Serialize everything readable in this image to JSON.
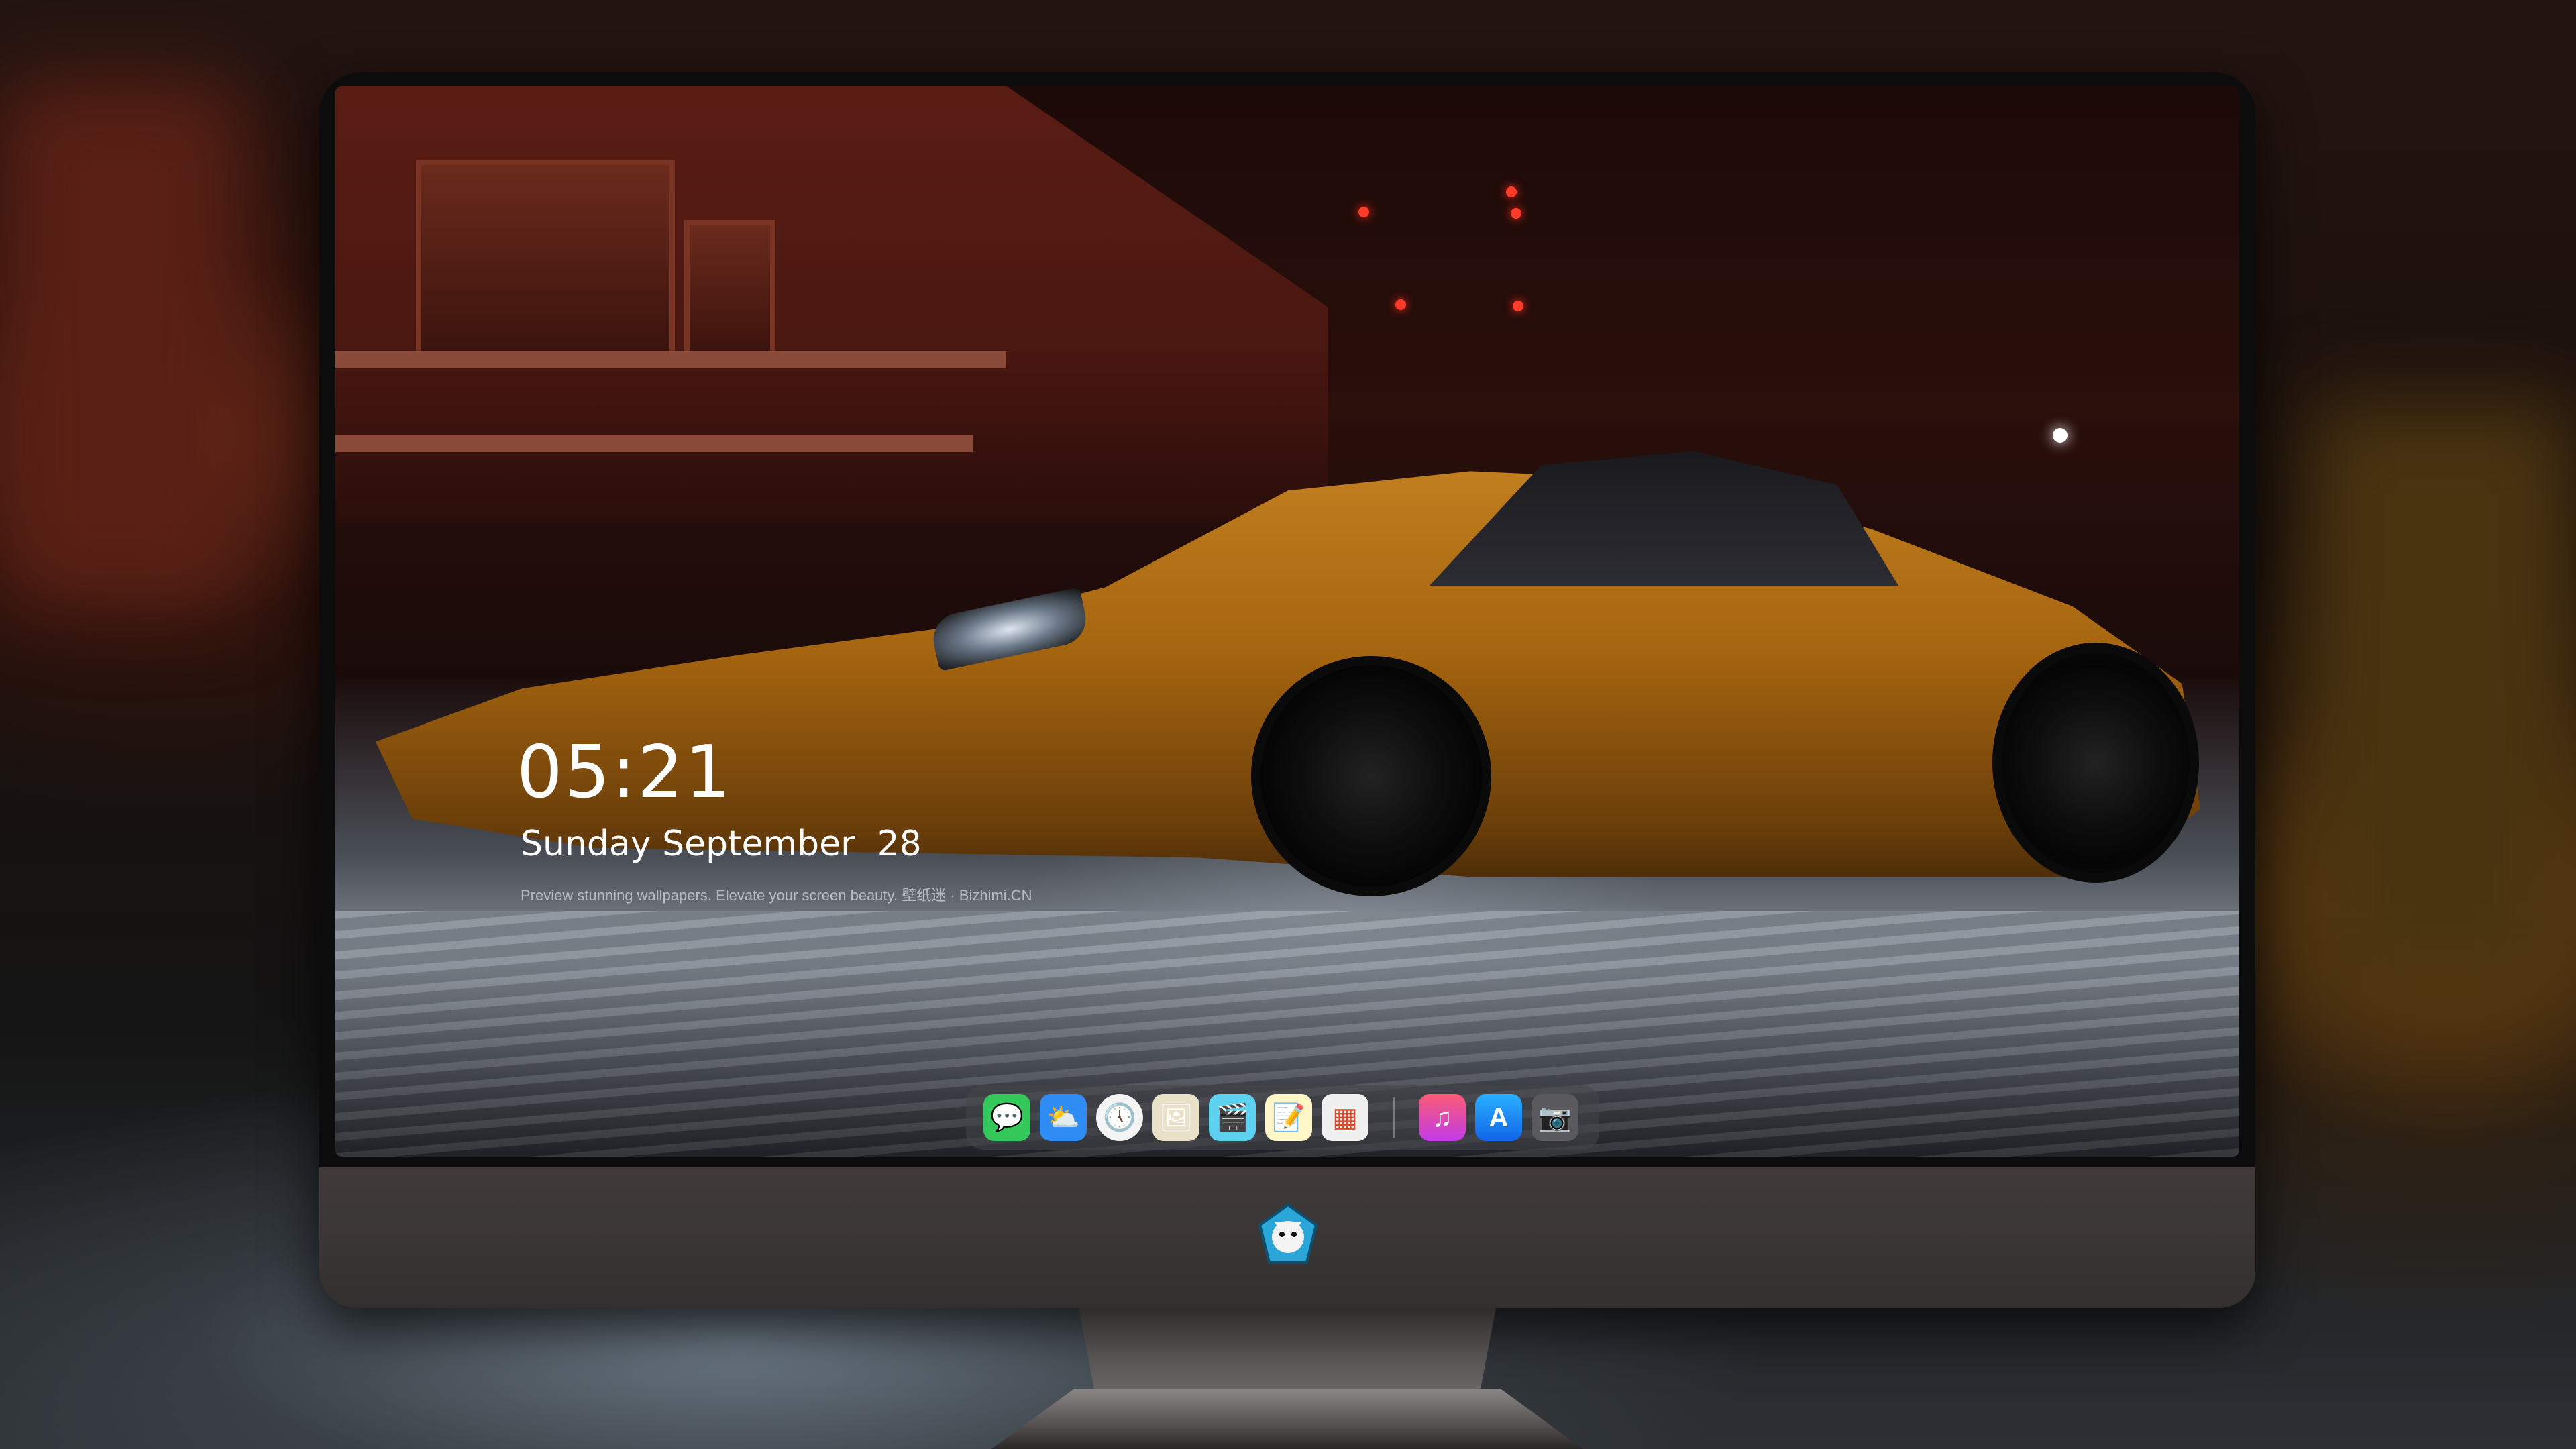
{
  "lockscreen": {
    "time": "05:21",
    "date": "Sunday September  28",
    "caption": "Preview stunning wallpapers. Elevate your screen beauty. 壁纸迷 · Bizhimi.CN"
  },
  "dock": {
    "apps": [
      {
        "name": "messages",
        "icon": "message-bubble-icon",
        "glyph": "💬",
        "color": "#34c759"
      },
      {
        "name": "weather",
        "icon": "weather-icon",
        "glyph": "⛅",
        "color": "#2f8cf5"
      },
      {
        "name": "clock",
        "icon": "clock-icon",
        "glyph": "🕔",
        "color": "#ffffff"
      },
      {
        "name": "preview",
        "icon": "preview-icon",
        "glyph": "🖼",
        "color": "#e9e2c8"
      },
      {
        "name": "clips",
        "icon": "clapperboard-icon",
        "glyph": "🎬",
        "color": "#5ed0f0"
      },
      {
        "name": "notes",
        "icon": "notes-icon",
        "glyph": "📝",
        "color": "#ffd84a"
      },
      {
        "name": "photo-booth",
        "icon": "photo-grid-icon",
        "glyph": "▦",
        "color": "#f0f0f0"
      },
      {
        "name": "music",
        "icon": "music-note-icon",
        "glyph": "♫",
        "color": "#f24cb8"
      },
      {
        "name": "app-store",
        "icon": "app-store-icon",
        "glyph": "A",
        "color": "#1e8ef5"
      },
      {
        "name": "camera",
        "icon": "camera-icon",
        "glyph": "📷",
        "color": "#555555"
      }
    ]
  },
  "colors": {
    "car": "#c28020",
    "monitor_chin": "#3a3535",
    "dock_bg": "#46464a"
  }
}
